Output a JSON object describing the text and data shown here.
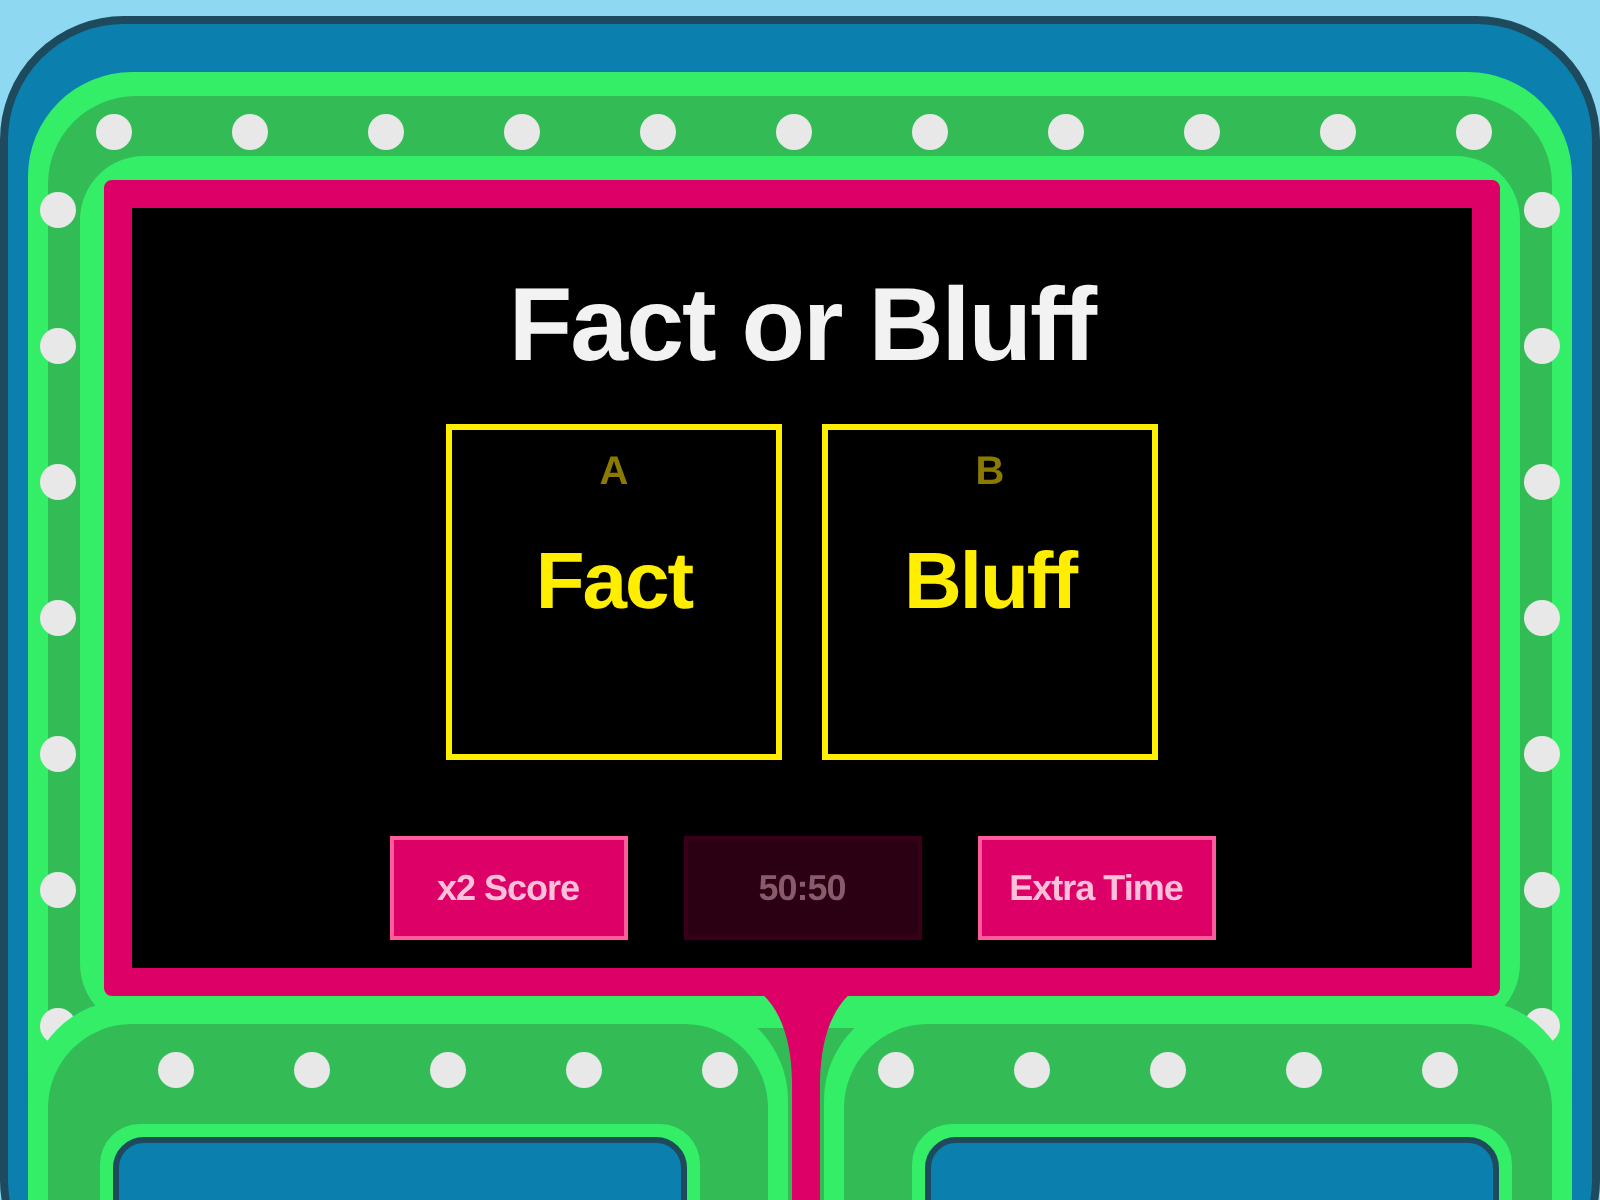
{
  "title": "Fact or Bluff",
  "answers": [
    {
      "letter": "A",
      "text": "Fact"
    },
    {
      "letter": "B",
      "text": "Bluff"
    }
  ],
  "powerups": [
    {
      "label": "x2 Score",
      "disabled": false
    },
    {
      "label": "50:50",
      "disabled": true
    },
    {
      "label": "Extra Time",
      "disabled": false
    }
  ]
}
